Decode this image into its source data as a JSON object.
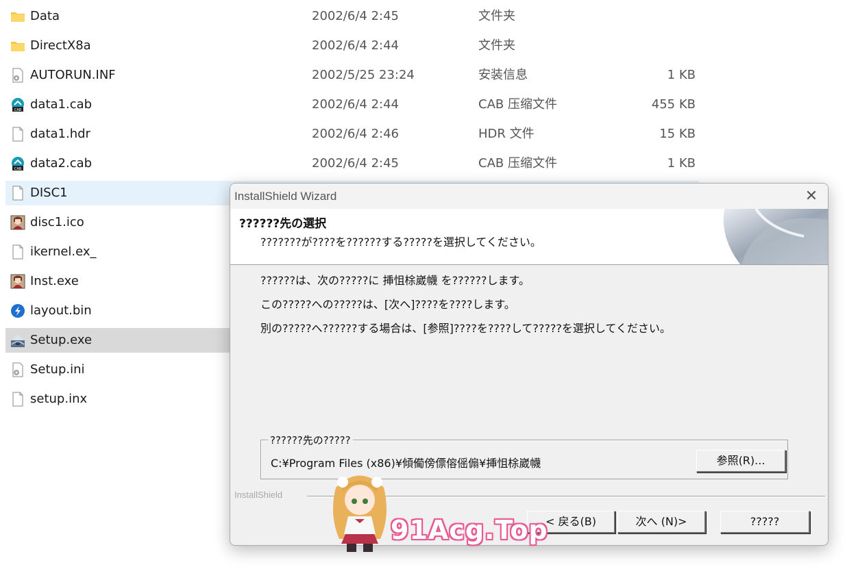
{
  "files": [
    {
      "name": "Data",
      "date": "2002/6/4 2:45",
      "type": "文件夹",
      "size": "",
      "icon": "folder-icon"
    },
    {
      "name": "DirectX8a",
      "date": "2002/6/4 2:44",
      "type": "文件夹",
      "size": "",
      "icon": "folder-icon"
    },
    {
      "name": "AUTORUN.INF",
      "date": "2002/5/25 23:24",
      "type": "安装信息",
      "size": "1 KB",
      "icon": "settings-file-icon"
    },
    {
      "name": "data1.cab",
      "date": "2002/6/4 2:44",
      "type": "CAB 压缩文件",
      "size": "455 KB",
      "icon": "cab-archive-icon"
    },
    {
      "name": "data1.hdr",
      "date": "2002/6/4 2:46",
      "type": "HDR 文件",
      "size": "15 KB",
      "icon": "blank-file-icon"
    },
    {
      "name": "data2.cab",
      "date": "2002/6/4 2:45",
      "type": "CAB 压缩文件",
      "size": "1 KB",
      "icon": "cab-archive-icon"
    },
    {
      "name": "DISC1",
      "date": "",
      "type": "",
      "size": "",
      "icon": "blank-file-icon"
    },
    {
      "name": "disc1.ico",
      "date": "",
      "type": "",
      "size": "",
      "icon": "character-image-icon"
    },
    {
      "name": "ikernel.ex_",
      "date": "",
      "type": "",
      "size": "",
      "icon": "blank-file-icon"
    },
    {
      "name": "Inst.exe",
      "date": "",
      "type": "",
      "size": "",
      "icon": "character-image-icon"
    },
    {
      "name": "layout.bin",
      "date": "",
      "type": "",
      "size": "",
      "icon": "blue-app-icon"
    },
    {
      "name": "Setup.exe",
      "date": "",
      "type": "",
      "size": "",
      "icon": "installer-icon"
    },
    {
      "name": "Setup.ini",
      "date": "",
      "type": "",
      "size": "",
      "icon": "settings-file-icon"
    },
    {
      "name": "setup.inx",
      "date": "",
      "type": "",
      "size": "",
      "icon": "blank-file-icon"
    }
  ],
  "dialog": {
    "title": "InstallShield Wizard",
    "close_glyph": "✕",
    "header_title": "??????先の選択",
    "header_subtitle": "???????が????を??????する?????を選択してください。",
    "line1": "??????は、次の?????に 挿怚梌崴幭 を??????します。",
    "line2": "この?????への?????は、[次へ]????を????します。",
    "line3": "別の?????へ??????する場合は、[参照]????を????して?????を選択してください。",
    "group_label": "??????先の?????",
    "dest_path": "C:¥Program Files (x86)¥傾僃傍僄傛傜傓¥挿怚梌崴幭",
    "browse_label": "参照(R)...",
    "brand": "InstallShield",
    "back_label": "< 戻る(B)",
    "next_label": "次へ (N)>",
    "cancel_label": "?????"
  },
  "watermark": {
    "text": "91Acg.Top"
  }
}
